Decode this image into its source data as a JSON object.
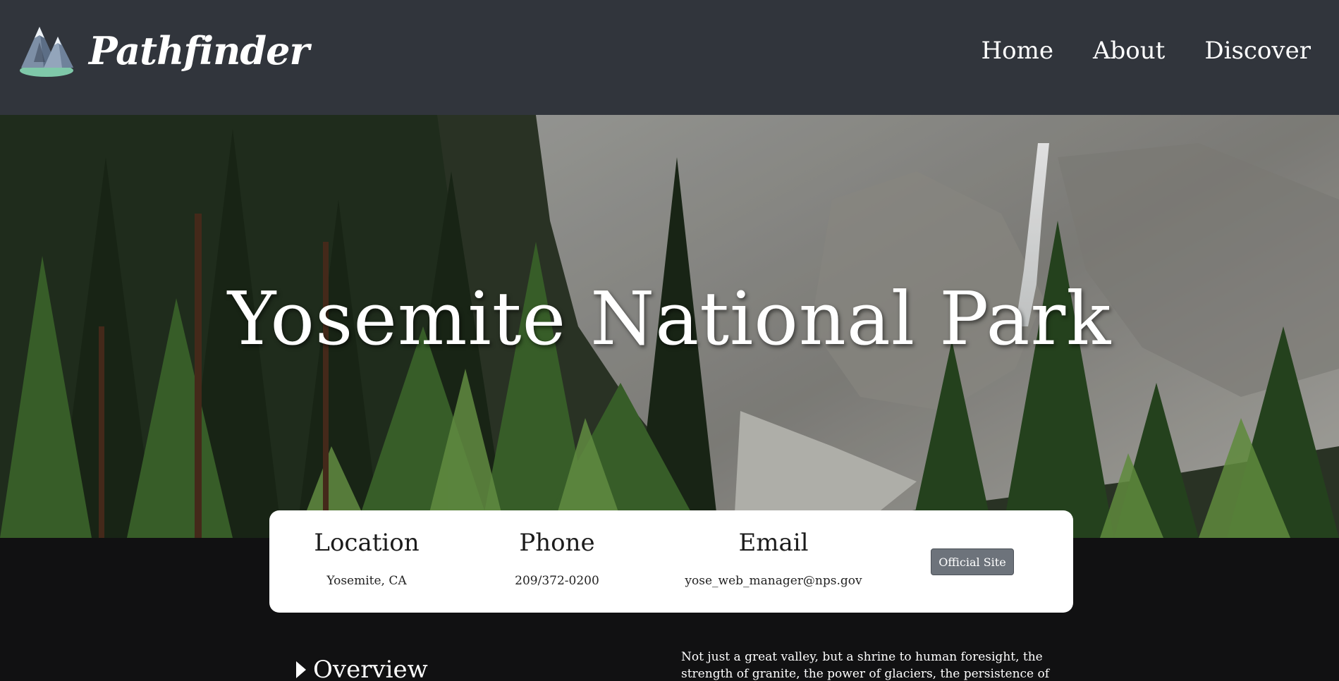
{
  "brand": {
    "name": "Pathfinder",
    "logo_icon": "mountain-logo-icon"
  },
  "nav": {
    "links": [
      "Home",
      "About",
      "Discover"
    ]
  },
  "hero": {
    "title": "Yosemite National Park"
  },
  "info": {
    "location_label": "Location",
    "location_value": "Yosemite, CA",
    "phone_label": "Phone",
    "phone_value": "209/372-0200",
    "email_label": "Email",
    "email_value": "yose_web_manager@nps.gov",
    "site_button": "Official Site"
  },
  "content": {
    "overview_label": "Overview",
    "description": "Not just a great valley, but a shrine to human foresight, the strength of granite, the power of glaciers, the persistence of life, and the"
  },
  "colors": {
    "nav_bg": "#31353c",
    "page_bg": "#111112",
    "button_bg": "#6d737b"
  }
}
